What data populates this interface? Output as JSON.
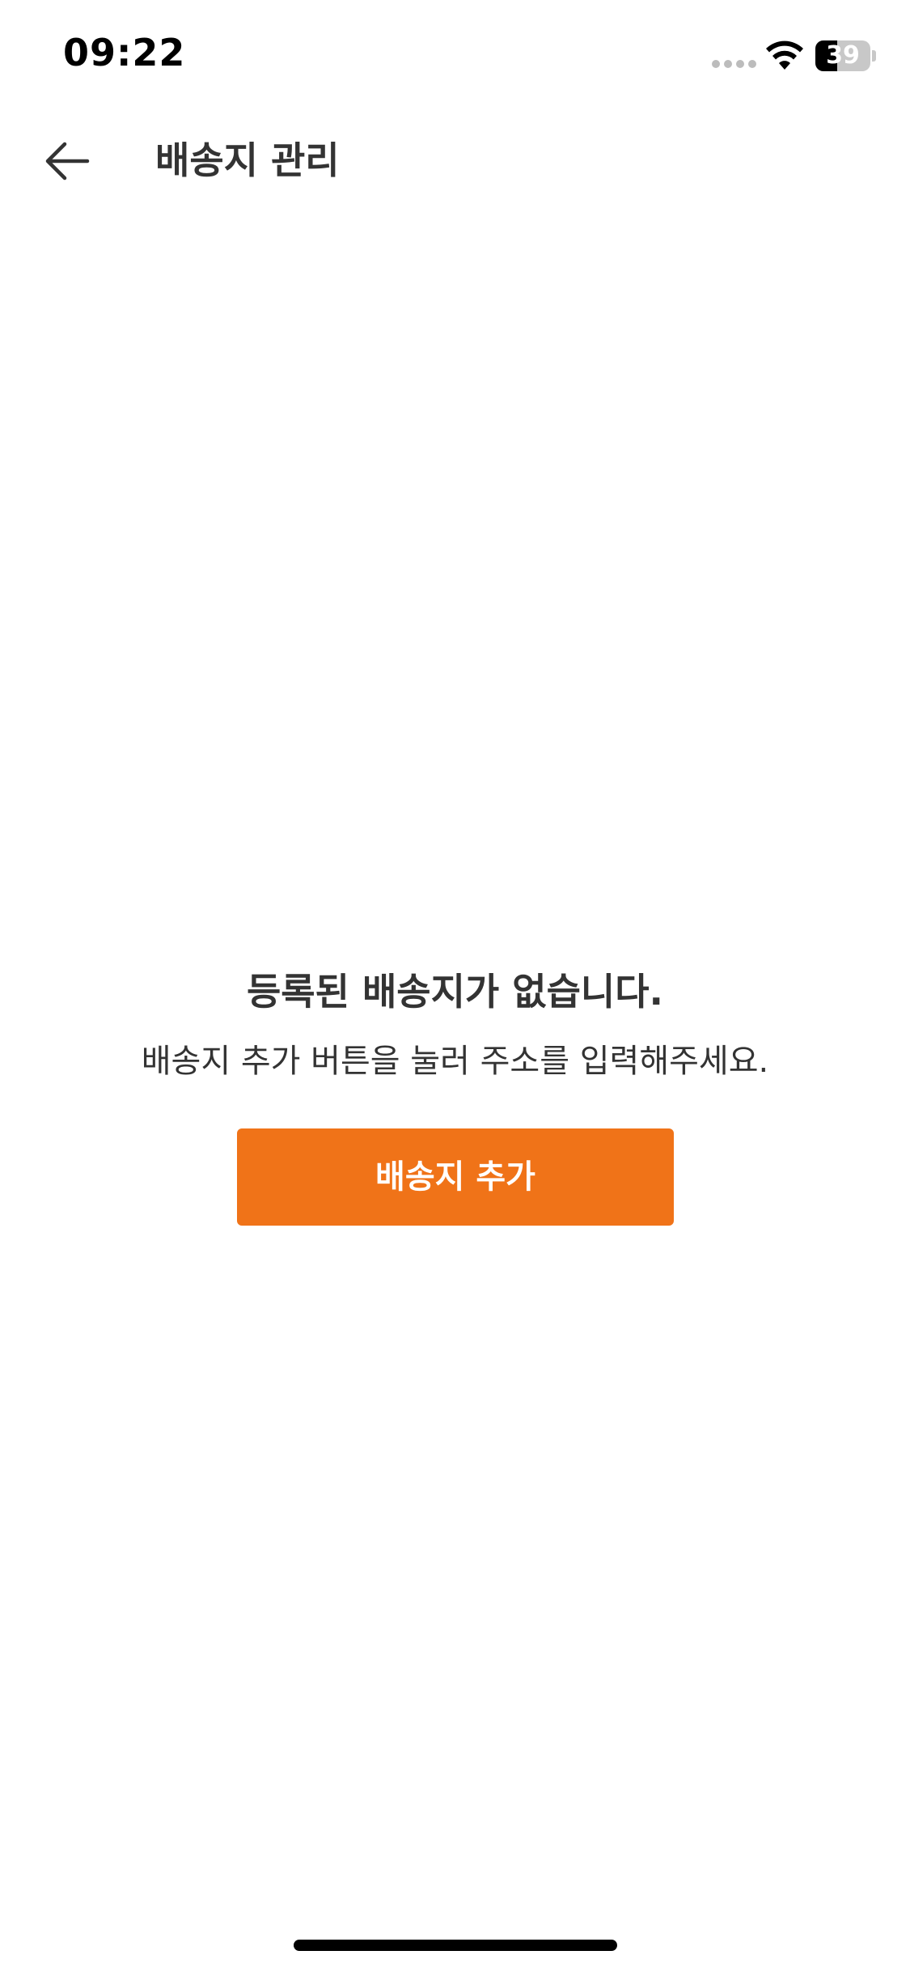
{
  "status_bar": {
    "time": "09:22",
    "battery_level": "39",
    "battery_fraction": 0.39,
    "signal_icon": "signal-dots-icon",
    "wifi_icon": "wifi-icon"
  },
  "header": {
    "back_icon": "arrow-left-icon",
    "title": "배송지 관리"
  },
  "empty_state": {
    "title": "등록된 배송지가 없습니다.",
    "description": "배송지 추가 버튼을 눌러 주소를 입력해주세요.",
    "add_button_label": "배송지 추가"
  },
  "colors": {
    "accent": "#F07318",
    "text": "#333333",
    "background": "#FFFFFF"
  }
}
